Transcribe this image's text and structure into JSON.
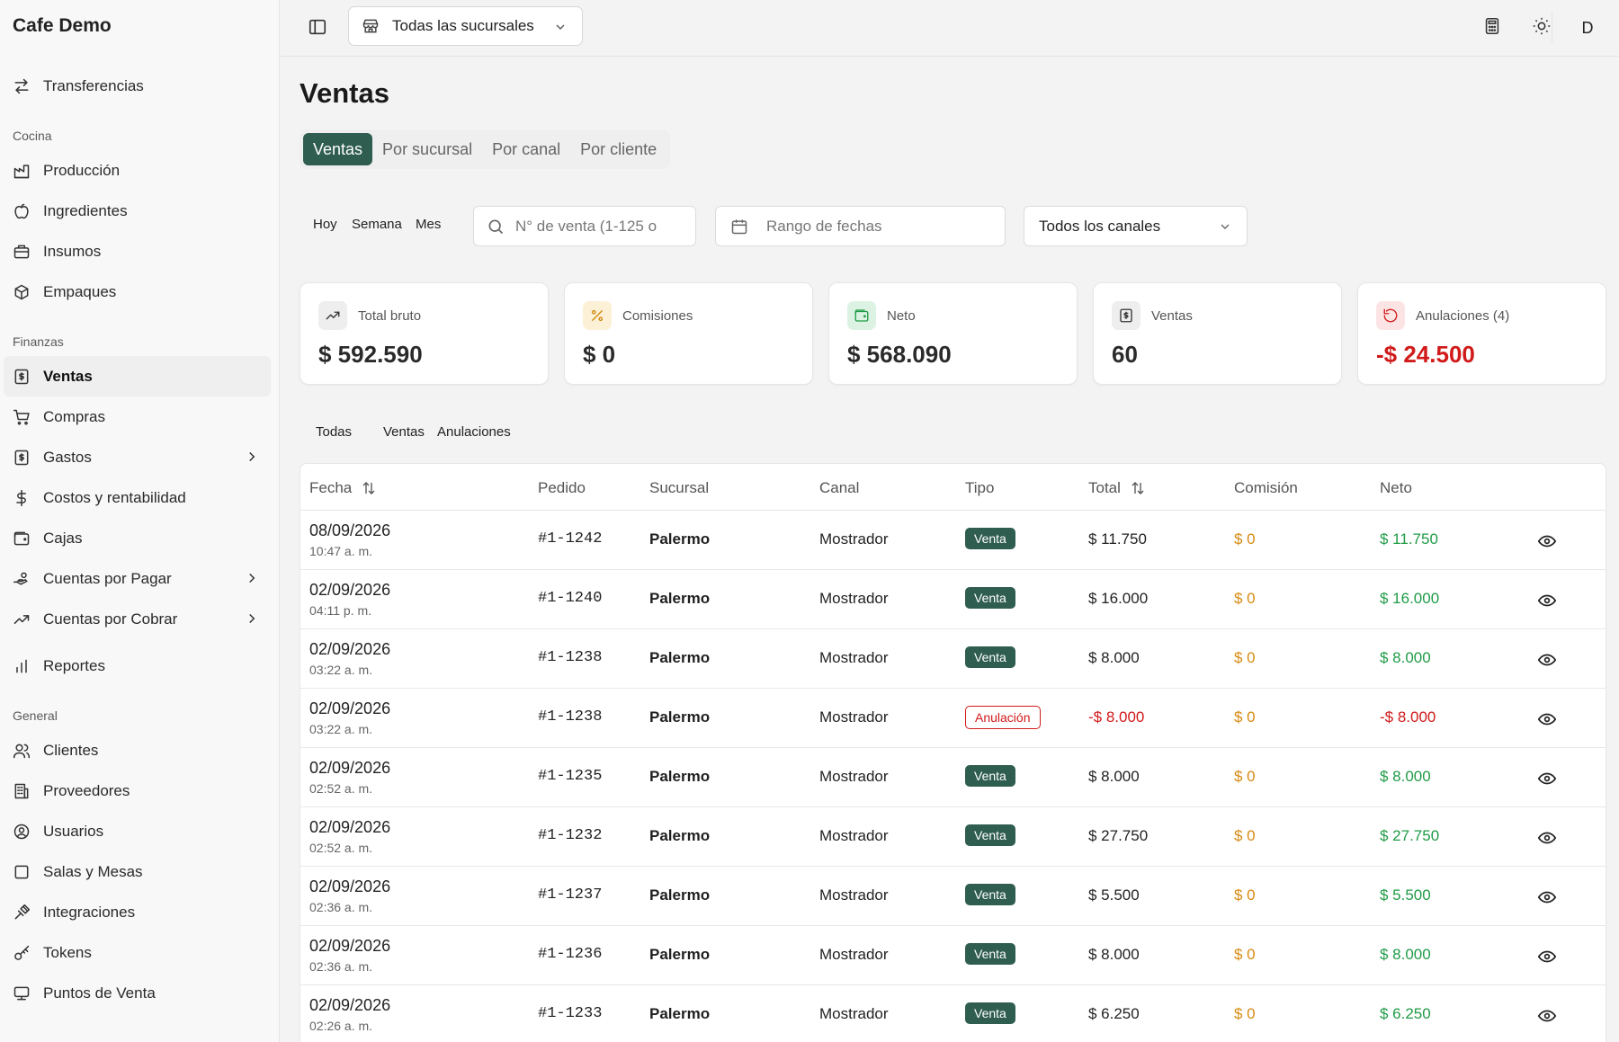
{
  "app": {
    "brand": "Cafe Demo"
  },
  "sidebar": {
    "top_items": [
      {
        "label": "Transferencias",
        "icon": "arrows-transfer-icon"
      }
    ],
    "sections": [
      {
        "title": "Cocina",
        "items": [
          {
            "label": "Producción",
            "icon": "factory-icon"
          },
          {
            "label": "Ingredientes",
            "icon": "apple-icon"
          },
          {
            "label": "Insumos",
            "icon": "box-icon"
          },
          {
            "label": "Empaques",
            "icon": "package-icon"
          }
        ]
      },
      {
        "title": "Finanzas",
        "items": [
          {
            "label": "Ventas",
            "icon": "receipt-icon",
            "active": true
          },
          {
            "label": "Compras",
            "icon": "cart-icon"
          },
          {
            "label": "Gastos",
            "icon": "receipt-icon",
            "chevron": true
          },
          {
            "label": "Costos y rentabilidad",
            "icon": "dollar-icon"
          },
          {
            "label": "Cajas",
            "icon": "wallet-icon"
          },
          {
            "label": "Cuentas por Pagar",
            "icon": "handcoins-icon",
            "chevron": true
          },
          {
            "label": "Cuentas por Cobrar",
            "icon": "trend-up-icon",
            "chevron": true
          }
        ]
      },
      {
        "title": "",
        "items": [
          {
            "label": "Reportes",
            "icon": "bar-chart-icon"
          }
        ]
      },
      {
        "title": "General",
        "items": [
          {
            "label": "Clientes",
            "icon": "users-icon"
          },
          {
            "label": "Proveedores",
            "icon": "building-icon"
          },
          {
            "label": "Usuarios",
            "icon": "user-circle-icon"
          },
          {
            "label": "Salas y Mesas",
            "icon": "square-icon"
          },
          {
            "label": "Integraciones",
            "icon": "plug-icon"
          },
          {
            "label": "Tokens",
            "icon": "key-icon"
          },
          {
            "label": "Puntos de Venta",
            "icon": "pos-icon"
          }
        ]
      }
    ]
  },
  "topbar": {
    "branch_label": "Todas las sucursales",
    "avatar_initial": "D"
  },
  "page": {
    "title": "Ventas",
    "tabs": [
      "Ventas",
      "Por sucursal",
      "Por canal",
      "Por cliente"
    ],
    "quick_filters": [
      "Hoy",
      "Semana",
      "Mes"
    ],
    "search_placeholder": "N° de venta (1-125 o",
    "date_placeholder": "Rango de fechas",
    "channel_value": "Todos los canales"
  },
  "stats": [
    {
      "label": "Total bruto",
      "value": "$ 592.590",
      "icon": "trend-up-icon",
      "badge_bg": "#eeeeee",
      "icon_color": "#333333",
      "value_color": "#2a2a2a"
    },
    {
      "label": "Comisiones",
      "value": "$ 0",
      "icon": "percent-icon",
      "badge_bg": "#fcf1d6",
      "icon_color": "#d08a10",
      "value_color": "#2a2a2a"
    },
    {
      "label": "Neto",
      "value": "$ 568.090",
      "icon": "wallet-icon",
      "badge_bg": "#dcf3e3",
      "icon_color": "#1f9b46",
      "value_color": "#2a2a2a"
    },
    {
      "label": "Ventas",
      "value": "60",
      "icon": "receipt-icon",
      "badge_bg": "#eeeeee",
      "icon_color": "#333333",
      "value_color": "#2a2a2a"
    },
    {
      "label": "Anulaciones (4)",
      "value": "-$ 24.500",
      "icon": "undo-icon",
      "badge_bg": "#fde4e4",
      "icon_color": "#d11a1a",
      "value_color": "#d11a1a"
    }
  ],
  "filter_tabs": [
    "Todas",
    "Ventas",
    "Anulaciones"
  ],
  "table": {
    "headers": [
      "Fecha",
      "Pedido",
      "Sucursal",
      "Canal",
      "Tipo",
      "Total",
      "Comisión",
      "Neto"
    ],
    "rows": [
      {
        "date": "08/09/2026",
        "time": "10:47 a. m.",
        "order": "#1-1242",
        "branch": "Palermo",
        "channel": "Mostrador",
        "type": "Venta",
        "total": "$ 11.750",
        "commission": "$ 0",
        "net": "$ 11.750"
      },
      {
        "date": "02/09/2026",
        "time": "04:11 p. m.",
        "order": "#1-1240",
        "branch": "Palermo",
        "channel": "Mostrador",
        "type": "Venta",
        "total": "$ 16.000",
        "commission": "$ 0",
        "net": "$ 16.000"
      },
      {
        "date": "02/09/2026",
        "time": "03:22 a. m.",
        "order": "#1-1238",
        "branch": "Palermo",
        "channel": "Mostrador",
        "type": "Venta",
        "total": "$ 8.000",
        "commission": "$ 0",
        "net": "$ 8.000"
      },
      {
        "date": "02/09/2026",
        "time": "03:22 a. m.",
        "order": "#1-1238",
        "branch": "Palermo",
        "channel": "Mostrador",
        "type": "Anulación",
        "total": "-$ 8.000",
        "commission": "$ 0",
        "net": "-$ 8.000"
      },
      {
        "date": "02/09/2026",
        "time": "02:52 a. m.",
        "order": "#1-1235",
        "branch": "Palermo",
        "channel": "Mostrador",
        "type": "Venta",
        "total": "$ 8.000",
        "commission": "$ 0",
        "net": "$ 8.000"
      },
      {
        "date": "02/09/2026",
        "time": "02:52 a. m.",
        "order": "#1-1232",
        "branch": "Palermo",
        "channel": "Mostrador",
        "type": "Venta",
        "total": "$ 27.750",
        "commission": "$ 0",
        "net": "$ 27.750"
      },
      {
        "date": "02/09/2026",
        "time": "02:36 a. m.",
        "order": "#1-1237",
        "branch": "Palermo",
        "channel": "Mostrador",
        "type": "Venta",
        "total": "$ 5.500",
        "commission": "$ 0",
        "net": "$ 5.500"
      },
      {
        "date": "02/09/2026",
        "time": "02:36 a. m.",
        "order": "#1-1236",
        "branch": "Palermo",
        "channel": "Mostrador",
        "type": "Venta",
        "total": "$ 8.000",
        "commission": "$ 0",
        "net": "$ 8.000"
      },
      {
        "date": "02/09/2026",
        "time": "02:26 a. m.",
        "order": "#1-1233",
        "branch": "Palermo",
        "channel": "Mostrador",
        "type": "Venta",
        "total": "$ 6.250",
        "commission": "$ 0",
        "net": "$ 6.250"
      }
    ]
  },
  "colors": {
    "accent": "#2f5d50",
    "positive": "#1f9b46",
    "negative": "#d11a1a",
    "commission": "#d78a12"
  }
}
